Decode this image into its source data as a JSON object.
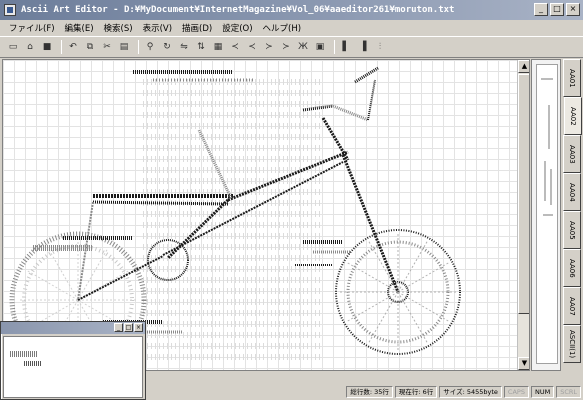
{
  "window": {
    "title": "Ascii Art Editor - D:¥MyDocument¥InternetMagazine¥Vol_06¥aaeditor261¥moruton.txt",
    "controls": {
      "minimize": "_",
      "maximize": "□",
      "close": "×"
    }
  },
  "menu": [
    {
      "label": "ファイル(F)"
    },
    {
      "label": "編集(E)"
    },
    {
      "label": "検索(S)"
    },
    {
      "label": "表示(V)"
    },
    {
      "label": "描画(D)"
    },
    {
      "label": "設定(O)"
    },
    {
      "label": "ヘルプ(H)"
    }
  ],
  "toolbar": [
    {
      "icon": "new-file-icon",
      "glyph": "▭"
    },
    {
      "icon": "open-folder-icon",
      "glyph": "⌂"
    },
    {
      "icon": "save-icon",
      "glyph": "■"
    },
    {
      "sep": true
    },
    {
      "icon": "undo-icon",
      "glyph": "↶"
    },
    {
      "icon": "copy-icon",
      "glyph": "⧉"
    },
    {
      "icon": "cut-icon",
      "glyph": "✂"
    },
    {
      "icon": "paste-icon",
      "glyph": "▤"
    },
    {
      "sep": true
    },
    {
      "icon": "find-icon",
      "glyph": "⚲"
    },
    {
      "icon": "rotate-icon",
      "glyph": "↻"
    },
    {
      "icon": "mirror-icon",
      "glyph": "⇋"
    },
    {
      "icon": "flip-icon",
      "glyph": "⇅"
    },
    {
      "icon": "grid-icon",
      "glyph": "▦"
    },
    {
      "icon": "shift-left-icon",
      "glyph": "≺"
    },
    {
      "icon": "shift-left-2-icon",
      "glyph": "≺"
    },
    {
      "icon": "shift-right-icon",
      "glyph": "≻"
    },
    {
      "icon": "shift-right-2-icon",
      "glyph": "≻"
    },
    {
      "icon": "text-icon",
      "glyph": "Ж"
    },
    {
      "icon": "image-icon",
      "glyph": "▣"
    },
    {
      "sep": true
    },
    {
      "icon": "layout-1-icon",
      "glyph": "▌"
    },
    {
      "icon": "layout-2-icon",
      "glyph": "▐"
    },
    {
      "icon": "layout-3-icon",
      "glyph": "⫶"
    }
  ],
  "tabs": [
    {
      "label": "AA01",
      "active": false
    },
    {
      "label": "AA02",
      "active": true
    },
    {
      "label": "AA03",
      "active": false
    },
    {
      "label": "AA04",
      "active": false
    },
    {
      "label": "AA05",
      "active": false
    },
    {
      "label": "AA06",
      "active": false
    },
    {
      "label": "AA07",
      "active": false
    },
    {
      "label": "ASCII(1)",
      "active": false
    }
  ],
  "status": {
    "lines": "総行数: 35行",
    "position": "現在行: 6行",
    "size": "サイズ: 5455byte",
    "caps": "CAPS",
    "num": "NUM",
    "scroll": "SCRL"
  },
  "colors": {
    "title_start": "#6c7d9a",
    "title_end": "#a9b3c6",
    "art_ink": "#1a1a1a",
    "art_shade": "#8a8a8a"
  }
}
